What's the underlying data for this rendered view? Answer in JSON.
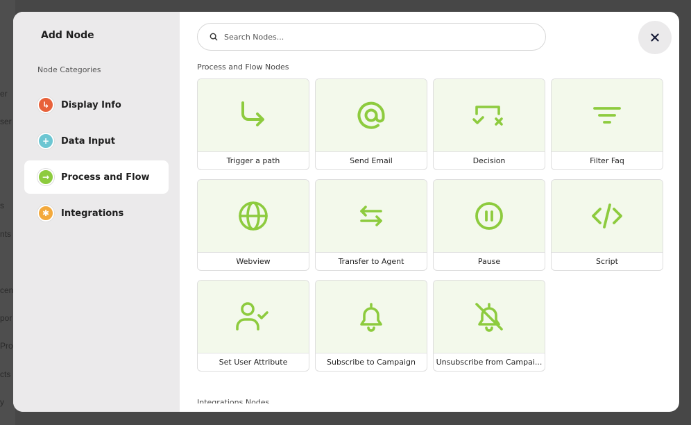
{
  "background": {
    "fragments": [
      "er",
      "ser",
      "s",
      "nts",
      "cen",
      "por",
      "Pro",
      "cts",
      "y"
    ]
  },
  "modal": {
    "title": "Add Node",
    "categories_label": "Node Categories",
    "categories": [
      {
        "label": "Display Info",
        "icon": "display-info-icon",
        "color": "#e8613a",
        "glyph": "↳",
        "active": false
      },
      {
        "label": "Data Input",
        "icon": "data-input-icon",
        "color": "#6cc6d2",
        "glyph": "+",
        "active": false
      },
      {
        "label": "Process and Flow",
        "icon": "process-flow-icon",
        "color": "#8dcb3e",
        "glyph": "→",
        "active": true
      },
      {
        "label": "Integrations",
        "icon": "integrations-icon",
        "color": "#f3a93c",
        "glyph": "✱",
        "active": false
      }
    ],
    "search": {
      "placeholder": "Search Nodes..."
    },
    "section_title": "Process and Flow Nodes",
    "next_section_title": "Integrations Nodes",
    "accent_color": "#8dcb3e",
    "nodes": [
      {
        "label": "Trigger a path",
        "icon": "trigger-path-icon"
      },
      {
        "label": "Send Email",
        "icon": "at-sign-icon"
      },
      {
        "label": "Decision",
        "icon": "decision-icon"
      },
      {
        "label": "Filter Faq",
        "icon": "filter-icon"
      },
      {
        "label": "Webview",
        "icon": "globe-icon"
      },
      {
        "label": "Transfer to Agent",
        "icon": "transfer-arrows-icon"
      },
      {
        "label": "Pause",
        "icon": "pause-icon"
      },
      {
        "label": "Script",
        "icon": "code-icon"
      },
      {
        "label": "Set User Attribute",
        "icon": "user-check-icon"
      },
      {
        "label": "Subscribe to Campaign",
        "icon": "bell-icon"
      },
      {
        "label": "Unsubscribe from Campai...",
        "icon": "bell-off-icon"
      }
    ]
  }
}
